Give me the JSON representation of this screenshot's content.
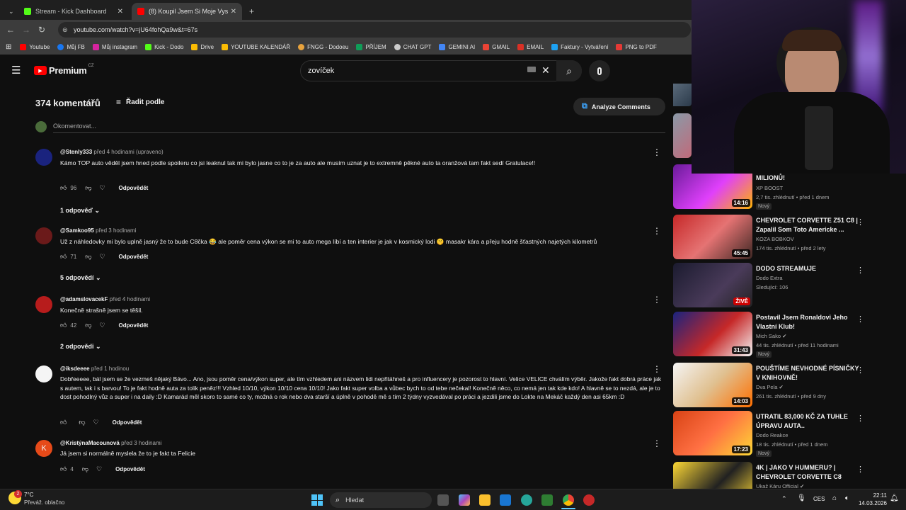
{
  "browser": {
    "tabs": [
      {
        "label": "Stream - Kick Dashboard"
      },
      {
        "label": "(8) Koupil Jsem Si Moje Vysněné"
      }
    ],
    "url": "youtube.com/watch?v=jU64fohQa9w&t=67s",
    "bookmarks": [
      "Youtube",
      "Můj FB",
      "Můj instagram",
      "Kick - Dodo",
      "Drive",
      "YOUTUBE KALENDÁŘ",
      "FNGG - Dodoeu",
      "PŘÍJEM",
      "CHAT GPT",
      "GEMINI AI",
      "GMAIL",
      "EMAIL",
      "Faktury - Vytváření",
      "PNG to PDF"
    ]
  },
  "youtube": {
    "logo": "Premium",
    "region": "CZ",
    "search_value": "zovíček"
  },
  "comments_header": {
    "count": "374 komentářů",
    "sort": "Řadit podle",
    "analyze": "Analyze Comments",
    "add_placeholder": "Okomentovat..."
  },
  "comments": [
    {
      "author": "@Stenly333",
      "time": "před 4 hodinami (upraveno)",
      "text": "Kámo TOP auto věděl jsem hned podle spoileru co jsi leaknul tak mi bylo jasne co to je za auto ale musím uznat je to extremně pěkné auto ta oranžová tam fakt sedí Gratulace!!",
      "likes": "96",
      "reply": "Odpovědět",
      "replies": "1 odpověď"
    },
    {
      "author": "@Samkoo95",
      "time": "před 3 hodinami",
      "text": "Už z náhledovky mi bylo uplně jasný že to bude C8čka 😂 ale poměr cena výkon se mi to auto mega líbí a ten interier je jak v kosmický lodi 🤫 masakr kára a přeju hodně šťastných najetých kilometrů",
      "likes": "71",
      "reply": "Odpovědět",
      "replies": "5 odpovědí"
    },
    {
      "author": "@adamslovacekF",
      "time": "před 4 hodinami",
      "text": "Konečně strašně jsem se těšil.",
      "likes": "42",
      "reply": "Odpovědět",
      "replies": "2 odpovědi"
    },
    {
      "author": "@iksdeeee",
      "time": "před 1 hodinou",
      "text": "Dobřeeeee, bál jsem se že vezmeš nějaký Bávo... Ano, jsou poměr cena/výkon super, ale tím vzhledem ani názvem lidi nepřitáhneš a pro influencery je pozorost to hlavní. Velice VELICE chválím výběr. Jakože fakt dobrá práce jak s autem, tak i s barvou! To je fakt hodně auta za tolik peněz!!! Vzhled 10/10, výkon 10/10 cena 10/10! Jako fakt super volba a vůbec bych to od tebe nečekal! Konečně něco, co nemá jen tak kde kdo! A hlavně se to nezdá, ale je to dost pohodlný vůz a super i na daily :D Kamarád měl skoro to samé co ty, možná o rok nebo dva starší a úplně v pohodě mě s tím 2 týdny vyzvedával po práci a jezdili jsme do Lokte na Mekáč každý den asi 65km :D",
      "likes": "",
      "reply": "Odpovědět",
      "replies": ""
    },
    {
      "author": "@KristýnaMacounová",
      "time": "před 3 hodinami",
      "text": "Já jsem si normálně myslela že to je fakt ta Felicie",
      "likes": "4",
      "reply": "Odpovědět",
      "replies": ""
    }
  ],
  "sidebar": [
    {
      "title": "MILIONŮ!",
      "channel": "XP BOOST",
      "meta": "2,7 tis. zhlédnutí • před 1 dnem",
      "badge": "Nový",
      "duration": "14:16"
    },
    {
      "title": "CHEVROLET CORVETTE Z51 C8 | Zapalil Som Toto Americke ...",
      "channel": "KOZA BOBKOV",
      "meta": "174 tis. zhlédnutí • před 2 lety",
      "badge": "",
      "duration": "45:45"
    },
    {
      "title": "DODO STREAMUJE",
      "channel": "Dodo Extra",
      "meta": "Sledující: 106",
      "badge": "",
      "duration": "ŽIVĚ"
    },
    {
      "title": "Postavil Jsem Ronaldovi Jeho Vlastní Klub!",
      "channel": "Mich Sako",
      "meta": "44 tis. zhlédnutí • před 11 hodinami",
      "badge": "Nový",
      "duration": "31:43"
    },
    {
      "title": "POUŠTÍME NEVHODNÉ PÍSNIČKY V KNIHOVNĚ!",
      "channel": "Dva Pela",
      "meta": "261 tis. zhlédnutí • před 9 dny",
      "badge": "",
      "duration": "14:03"
    },
    {
      "title": "UTRATIL 83,000 KČ ZA TUHLE ÚPRAVU AUTA..",
      "channel": "Dodo Reakce",
      "meta": "18 tis. zhlédnutí • před 1 dnem",
      "badge": "Nový",
      "duration": "17:23"
    },
    {
      "title": "4K | JAKO V HUMMERU? | CHEVROLET CORVETTE C8",
      "channel": "Ukaž Káru Official",
      "meta": "",
      "badge": "",
      "duration": ""
    }
  ],
  "taskbar": {
    "weather_temp": "7°C",
    "weather_desc": "Převáž. oblačno",
    "weather_alerts": "2",
    "search": "Hledat",
    "lang": "CES",
    "time": "22:11",
    "date": "14.03.2026"
  },
  "colors": {
    "yt_red": "#ff0000",
    "bg": "#0f0f0f",
    "text": "#f1f1f1",
    "secondary": "#aaaaaa"
  }
}
